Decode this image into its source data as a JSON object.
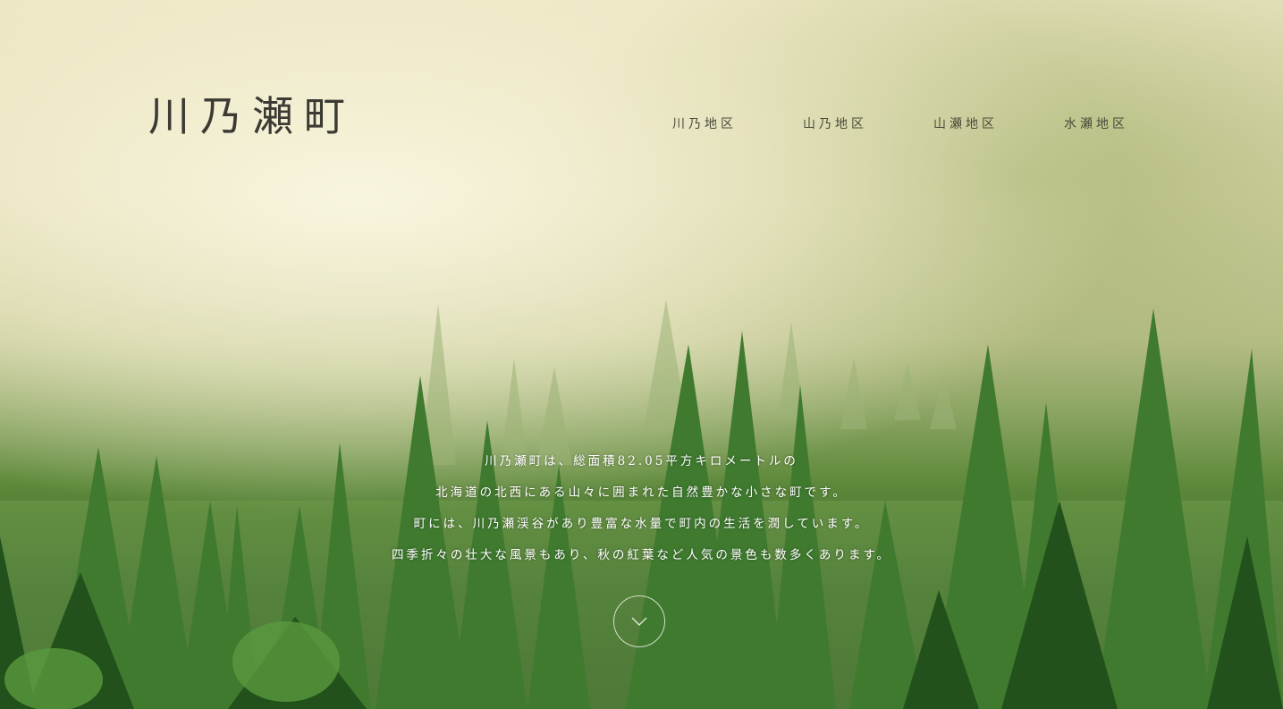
{
  "site": {
    "logo": "川乃瀬町"
  },
  "nav": {
    "items": [
      {
        "label": "川乃地区"
      },
      {
        "label": "山乃地区"
      },
      {
        "label": "山瀬地区"
      },
      {
        "label": "水瀬地区"
      }
    ]
  },
  "intro": {
    "lines": [
      "川乃瀬町は、総面積82.05平方キロメートルの",
      "北海道の北西にある山々に囲まれた自然豊かな小さな町です。",
      "町には、川乃瀬渓谷があり豊富な水量で町内の生活を潤しています。",
      "四季折々の壮大な風景もあり、秋の紅葉など人気の景色も数多くあります。"
    ]
  },
  "scroll": {
    "icon": "chevron-down-icon"
  },
  "colors": {
    "mist": "#ece7c4",
    "forest": "#2f5f25",
    "logo_text": "#3b3a33",
    "nav_text": "#4a4a3a",
    "intro_text": "#ffffff"
  }
}
